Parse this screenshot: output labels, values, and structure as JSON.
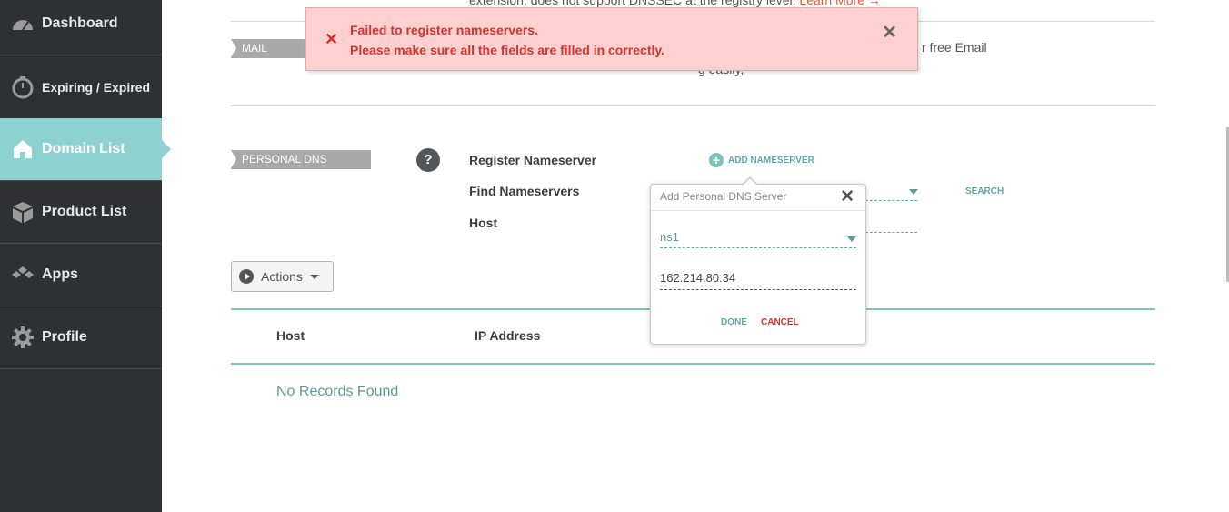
{
  "sidebar": {
    "items": [
      {
        "label": "Dashboard",
        "icon": "speedometer-icon"
      },
      {
        "label": "Expiring / Expired",
        "icon": "timer-icon"
      },
      {
        "label": "Domain List",
        "icon": "home-icon",
        "active": true
      },
      {
        "label": "Product List",
        "icon": "box-icon"
      },
      {
        "label": "Apps",
        "icon": "apps-icon"
      },
      {
        "label": "Profile",
        "icon": "gear-icon"
      }
    ]
  },
  "dnssec": {
    "text": "extension, does not support DNSSEC at the registry level.",
    "link": "Learn More →"
  },
  "mail": {
    "tag": "MAIL SETTINGS",
    "text_right": "r free Email",
    "text_below": "g easily,"
  },
  "personal_dns": {
    "tag": "PERSONAL DNS SERVER",
    "help": "?",
    "register_label": "Register Nameserver",
    "find_label": "Find Nameservers",
    "host_label": "Host",
    "add_ns": "ADD NAMESERVER",
    "search": "SEARCH"
  },
  "actions": {
    "label": "Actions"
  },
  "table": {
    "col_host": "Host",
    "col_ip": "IP Address",
    "empty": "No Records Found"
  },
  "alert": {
    "line1": "Failed to register nameservers.",
    "line2": "Please make sure all the fields are filled in correctly."
  },
  "popup": {
    "title": "Add Personal DNS Server",
    "select_value": "ns1",
    "ip_value": "162.214.80.34",
    "done": "DONE",
    "cancel": "CANCEL"
  },
  "colors": {
    "accent": "#8dd1d0",
    "error": "#d7332f",
    "sidebar": "#2f3032"
  }
}
